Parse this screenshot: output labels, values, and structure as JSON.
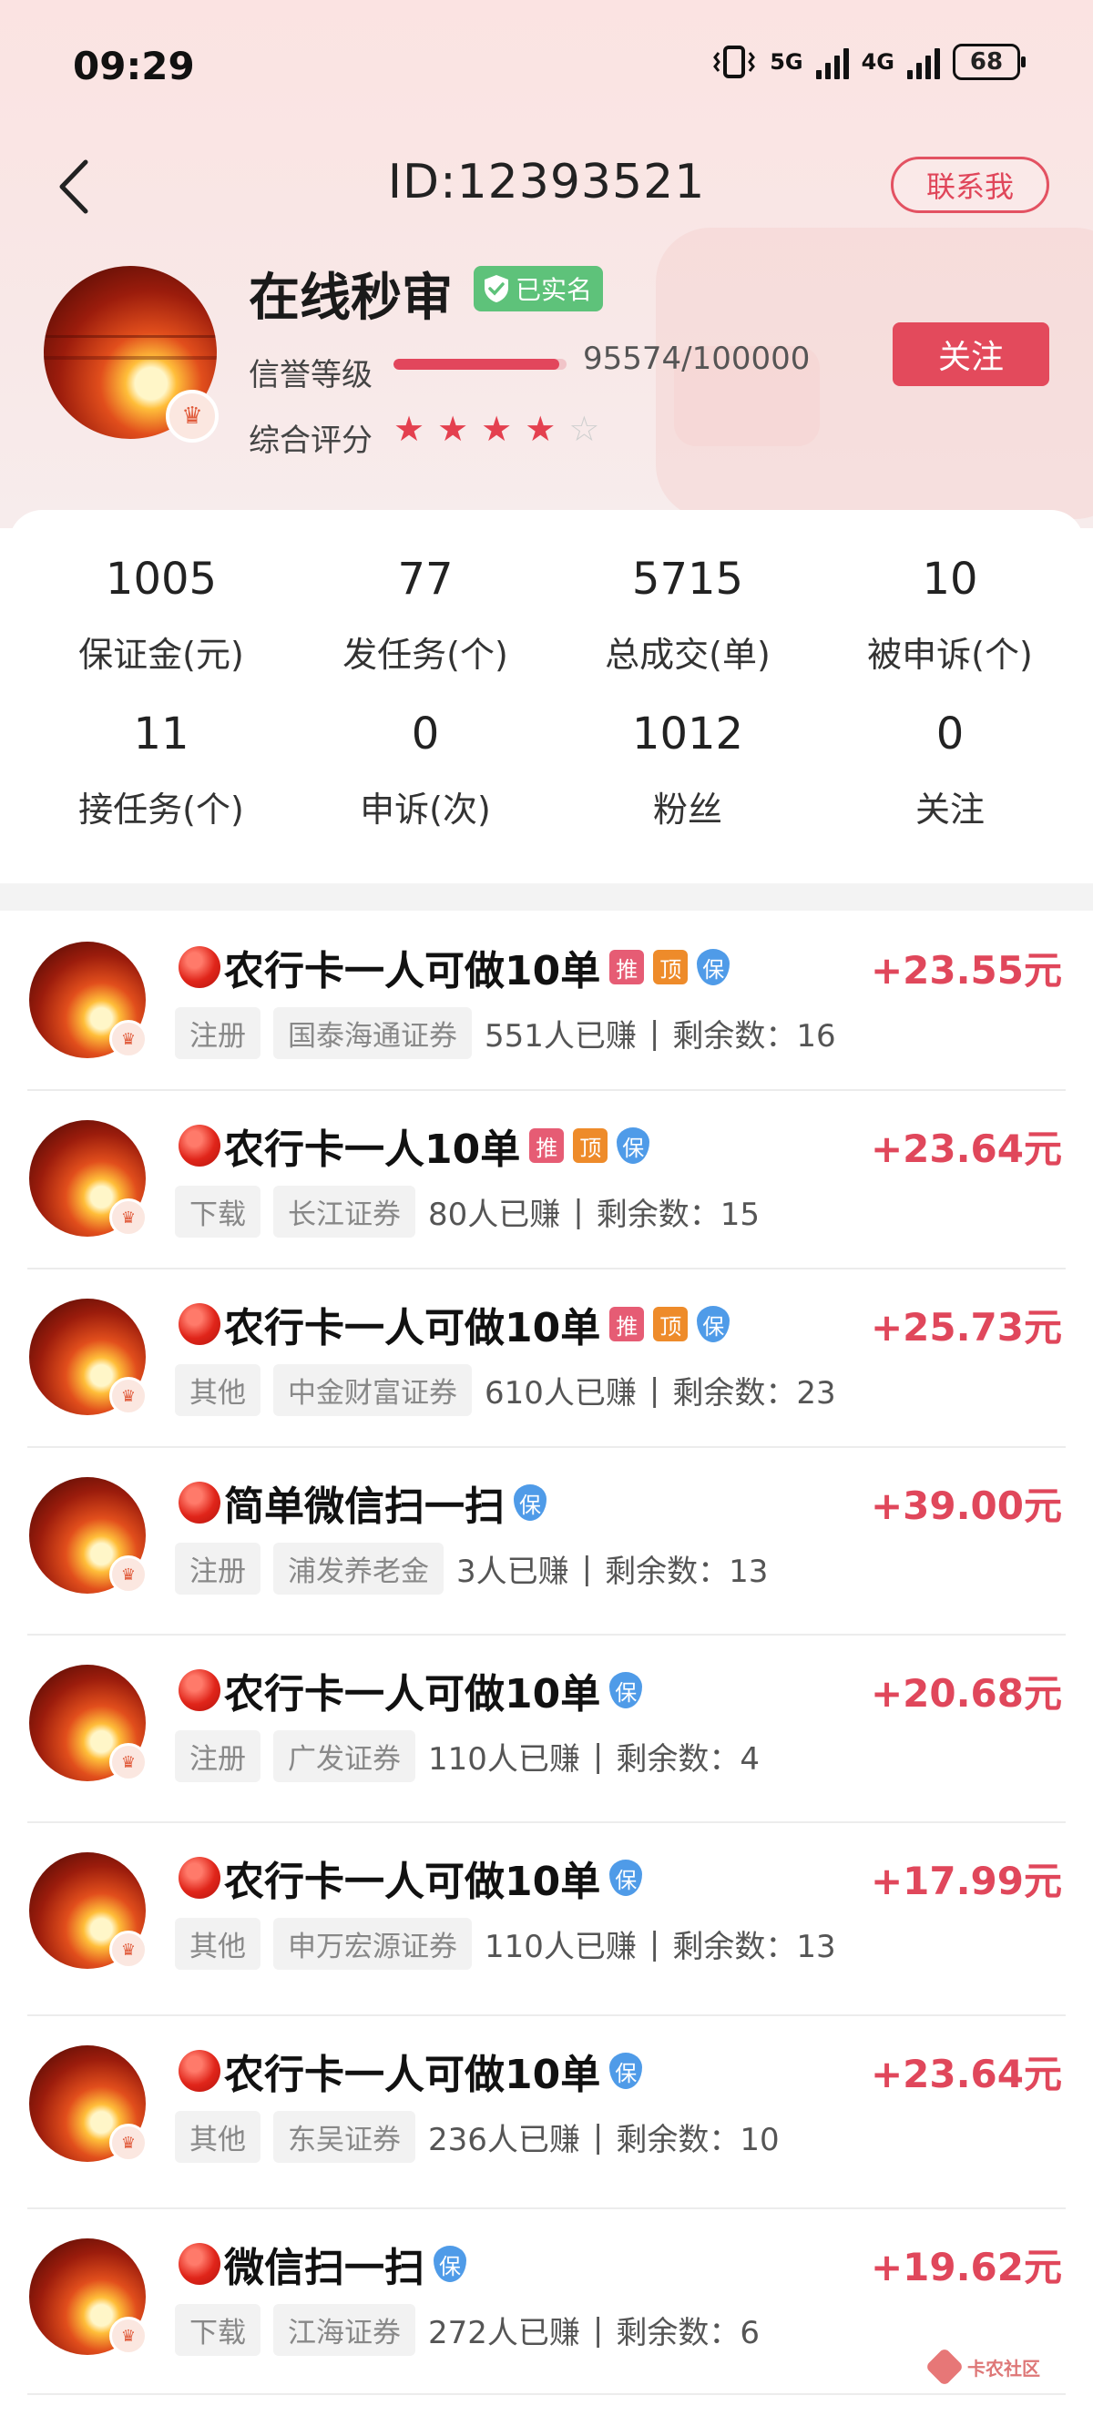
{
  "status_bar": {
    "time": "09:29",
    "net1": "5G",
    "net2": "4G",
    "battery": "68"
  },
  "header": {
    "id_text": "ID:12393521",
    "contact_label": "联系我"
  },
  "profile": {
    "nickname": "在线秒审",
    "verified_label": "已实名",
    "credit_label": "信誉等级",
    "credit_value": "95574/100000",
    "credit_fraction": 0.9557,
    "score_label": "综合评分",
    "rating": 4,
    "rating_max": 5,
    "follow_label": "关注",
    "avatar_badge": "♛"
  },
  "stats": [
    {
      "value": "1005",
      "label": "保证金(元)"
    },
    {
      "value": "77",
      "label": "发任务(个)"
    },
    {
      "value": "5715",
      "label": "总成交(单)"
    },
    {
      "value": "10",
      "label": "被申诉(个)"
    },
    {
      "value": "11",
      "label": "接任务(个)"
    },
    {
      "value": "0",
      "label": "申诉(次)"
    },
    {
      "value": "1012",
      "label": "粉丝"
    },
    {
      "value": "0",
      "label": "关注"
    }
  ],
  "tasks": [
    {
      "title": "农行卡一人可做10单",
      "chips": [
        "推",
        "顶",
        "保"
      ],
      "price": "+23.55元",
      "type": "注册",
      "company": "国泰海通证券",
      "earned": "551人已赚",
      "remaining": "剩余数：16"
    },
    {
      "title": "农行卡一人10单",
      "chips": [
        "推",
        "顶",
        "保"
      ],
      "price": "+23.64元",
      "type": "下载",
      "company": "长江证券",
      "earned": "80人已赚",
      "remaining": "剩余数：15"
    },
    {
      "title": "农行卡一人可做10单",
      "chips": [
        "推",
        "顶",
        "保"
      ],
      "price": "+25.73元",
      "type": "其他",
      "company": "中金财富证券",
      "earned": "610人已赚",
      "remaining": "剩余数：23"
    },
    {
      "title": "简单微信扫一扫",
      "chips": [
        "保"
      ],
      "price": "+39.00元",
      "type": "注册",
      "company": "浦发养老金",
      "earned": "3人已赚",
      "remaining": "剩余数：13"
    },
    {
      "title": "农行卡一人可做10单",
      "chips": [
        "保"
      ],
      "price": "+20.68元",
      "type": "注册",
      "company": "广发证券",
      "earned": "110人已赚",
      "remaining": "剩余数：4"
    },
    {
      "title": "农行卡一人可做10单",
      "chips": [
        "保"
      ],
      "price": "+17.99元",
      "type": "其他",
      "company": "申万宏源证券",
      "earned": "110人已赚",
      "remaining": "剩余数：13"
    },
    {
      "title": "农行卡一人可做10单",
      "chips": [
        "保"
      ],
      "price": "+23.64元",
      "type": "其他",
      "company": "东吴证券",
      "earned": "236人已赚",
      "remaining": "剩余数：10"
    },
    {
      "title": "微信扫一扫",
      "chips": [
        "保"
      ],
      "price": "+19.62元",
      "type": "下载",
      "company": "江海证券",
      "earned": "272人已赚",
      "remaining": "剩余数：6"
    }
  ],
  "watermark": {
    "text": "卡农社区"
  },
  "colors": {
    "accent": "#e34a5c",
    "price": "#e0475b",
    "verified": "#5ec27a",
    "star_on": "#e4404f"
  }
}
